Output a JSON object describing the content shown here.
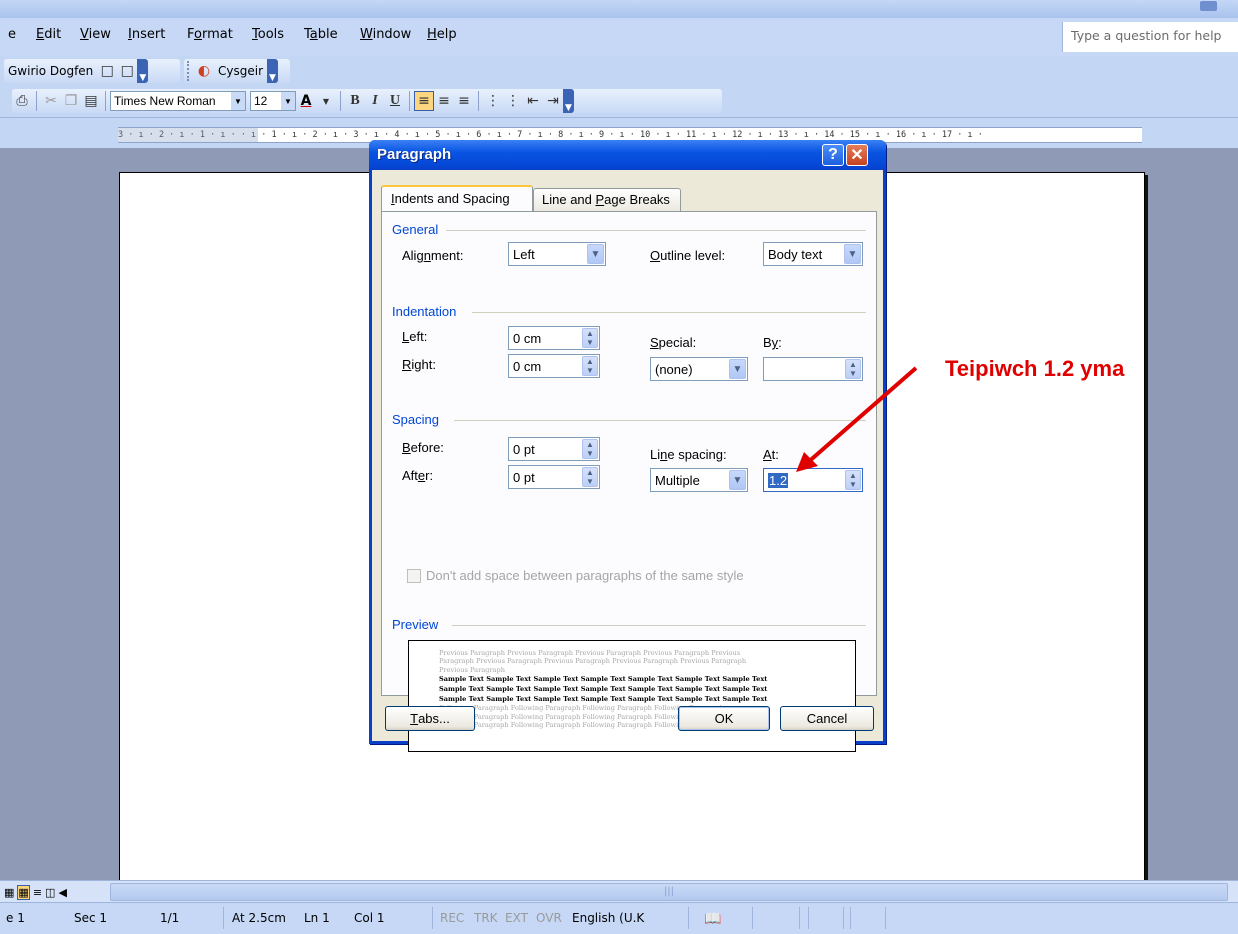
{
  "menubar": {
    "items": [
      {
        "label": "e",
        "u": ""
      },
      {
        "label": "Edit",
        "u": "E"
      },
      {
        "label": "View",
        "u": "V"
      },
      {
        "label": "Insert",
        "u": "I"
      },
      {
        "label": "Format",
        "u": "o"
      },
      {
        "label": "Tools",
        "u": "T"
      },
      {
        "label": "Table",
        "u": "a"
      },
      {
        "label": "Window",
        "u": "W"
      },
      {
        "label": "Help",
        "u": "H"
      }
    ],
    "ask_placeholder": "Type a question for help"
  },
  "toolbar1": {
    "dogfen_label": "Gwirio Dogfen",
    "cysgeir_label": "Cysgeir"
  },
  "toolbar2": {
    "font_name": "Times New Roman",
    "font_size": "12",
    "bold": "B",
    "italic": "I",
    "underline": "U"
  },
  "ruler": {
    "text": "3 · ı · 2 · ı · 1 · ı ·    · ı · 1 · ı · 2 · ı · 3 · ı · 4 · ı · 5 · ı · 6 · ı · 7 · ı · 8 · ı · 9 · ı · 10 · ı · 11 · ı · 12 · ı · 13 · ı · 14 ·  15 · ı · 16 · ı · 17 · ı ·"
  },
  "dialog": {
    "title": "Paragraph",
    "help_label": "?",
    "close_label": "✕",
    "tabs": [
      {
        "label": "Indents and Spacing",
        "active": true
      },
      {
        "label": "Line and Page Breaks",
        "active": false
      }
    ],
    "general": {
      "heading": "General",
      "alignment_label": "Alignment:",
      "alignment_value": "Left",
      "outline_label": "Outline level:",
      "outline_value": "Body text"
    },
    "indentation": {
      "heading": "Indentation",
      "left_label": "Left:",
      "left_value": "0 cm",
      "right_label": "Right:",
      "right_value": "0 cm",
      "special_label": "Special:",
      "special_value": "(none)",
      "by_label": "By:",
      "by_value": ""
    },
    "spacing": {
      "heading": "Spacing",
      "before_label": "Before:",
      "before_value": "0 pt",
      "after_label": "After:",
      "after_value": "0 pt",
      "line_spacing_label": "Line spacing:",
      "line_spacing_value": "Multiple",
      "at_label": "At:",
      "at_value": "1.2",
      "dont_add_label": "Don't add space between paragraphs of the same style"
    },
    "preview": {
      "heading": "Preview",
      "previous_lines": [
        "Previous Paragraph Previous Paragraph Previous Paragraph Previous Paragraph Previous",
        "Paragraph Previous Paragraph Previous Paragraph Previous Paragraph Previous Paragraph",
        "Previous Paragraph"
      ],
      "sample_lines": [
        "Sample Text Sample Text Sample Text Sample Text Sample Text Sample Text Sample Text",
        "Sample Text Sample Text Sample Text Sample Text Sample Text Sample Text Sample Text",
        "Sample Text Sample Text Sample Text Sample Text Sample Text Sample Text Sample Text"
      ],
      "following_lines": [
        "Following Paragraph Following Paragraph Following Paragraph Following Paragraph",
        "Following Paragraph Following Paragraph Following Paragraph Following Paragraph",
        "Following Paragraph Following Paragraph Following Paragraph Following Paragraph"
      ]
    },
    "buttons": {
      "tabs": "Tabs...",
      "ok": "OK",
      "cancel": "Cancel"
    }
  },
  "annotation": {
    "text": "Teipiwch 1.2 yma",
    "color": "#e00000"
  },
  "statusbar": {
    "page": "e 1",
    "sec": "Sec 1",
    "pages": "1/1",
    "at": "At 2.5cm",
    "ln": "Ln 1",
    "col": "Col 1",
    "rec": "REC",
    "trk": "TRK",
    "ext": "EXT",
    "ovr": "OVR",
    "language": "English (U.K"
  }
}
